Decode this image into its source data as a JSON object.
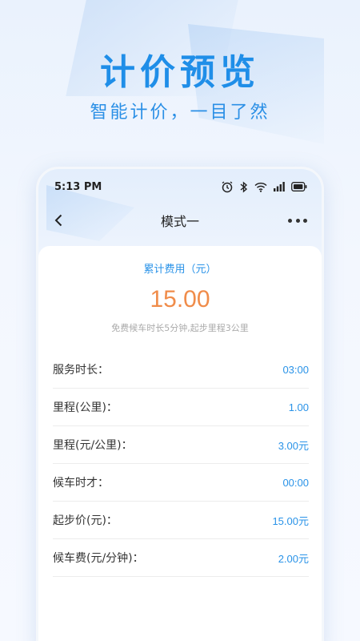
{
  "banner": {
    "headline": "计价预览",
    "subline": "智能计价，一目了然"
  },
  "status_bar": {
    "time": "5:13 PM",
    "icons": [
      "alarm-icon",
      "bluetooth-icon",
      "wifi-icon",
      "signal-icon",
      "battery-icon"
    ]
  },
  "nav": {
    "title": "模式一",
    "back_icon": "chevron-left-icon",
    "more_icon": "more-dots-icon"
  },
  "fee": {
    "label": "累计费用（元）",
    "amount": "15.00",
    "note": "免费候车时长5分钟,起步里程3公里"
  },
  "rows": [
    {
      "label": "服务时长：",
      "value": "03:00"
    },
    {
      "label": "里程(公里)：",
      "value": "1.00"
    },
    {
      "label": "里程(元/公里)：",
      "value": "3.00元"
    },
    {
      "label": "候车时才：",
      "value": "00:00"
    },
    {
      "label": "起步价(元)：",
      "value": "15.00元"
    },
    {
      "label": "候车费(元/分钟)：",
      "value": "2.00元"
    }
  ],
  "colors": {
    "accent": "#2a93e8",
    "amount": "#f08c4a",
    "headline": "#1f8ee8"
  }
}
